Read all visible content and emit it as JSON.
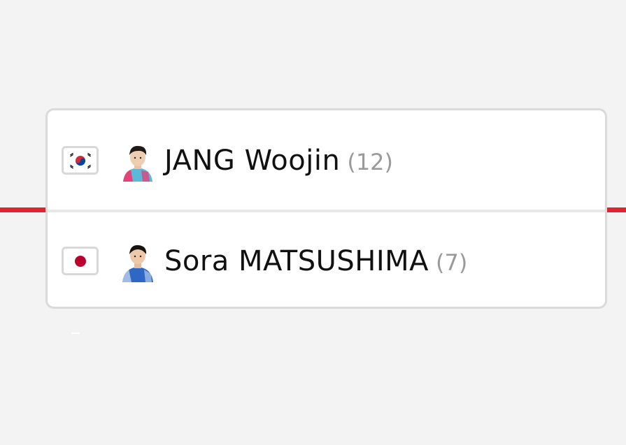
{
  "colors": {
    "accent_line": "#e02331",
    "name_text": "#111111",
    "seed_text": "#9a9a9a"
  },
  "players": [
    {
      "country": "Korea",
      "flag_icon": "south-korea-flag-icon",
      "avatar_icon": "player-avatar-icon",
      "name": "JANG Woojin",
      "seed": "(12)"
    },
    {
      "country": "Japan",
      "flag_icon": "japan-flag-icon",
      "avatar_icon": "player-avatar-icon",
      "name": "Sora MATSUSHIMA",
      "seed": "(7)"
    }
  ]
}
